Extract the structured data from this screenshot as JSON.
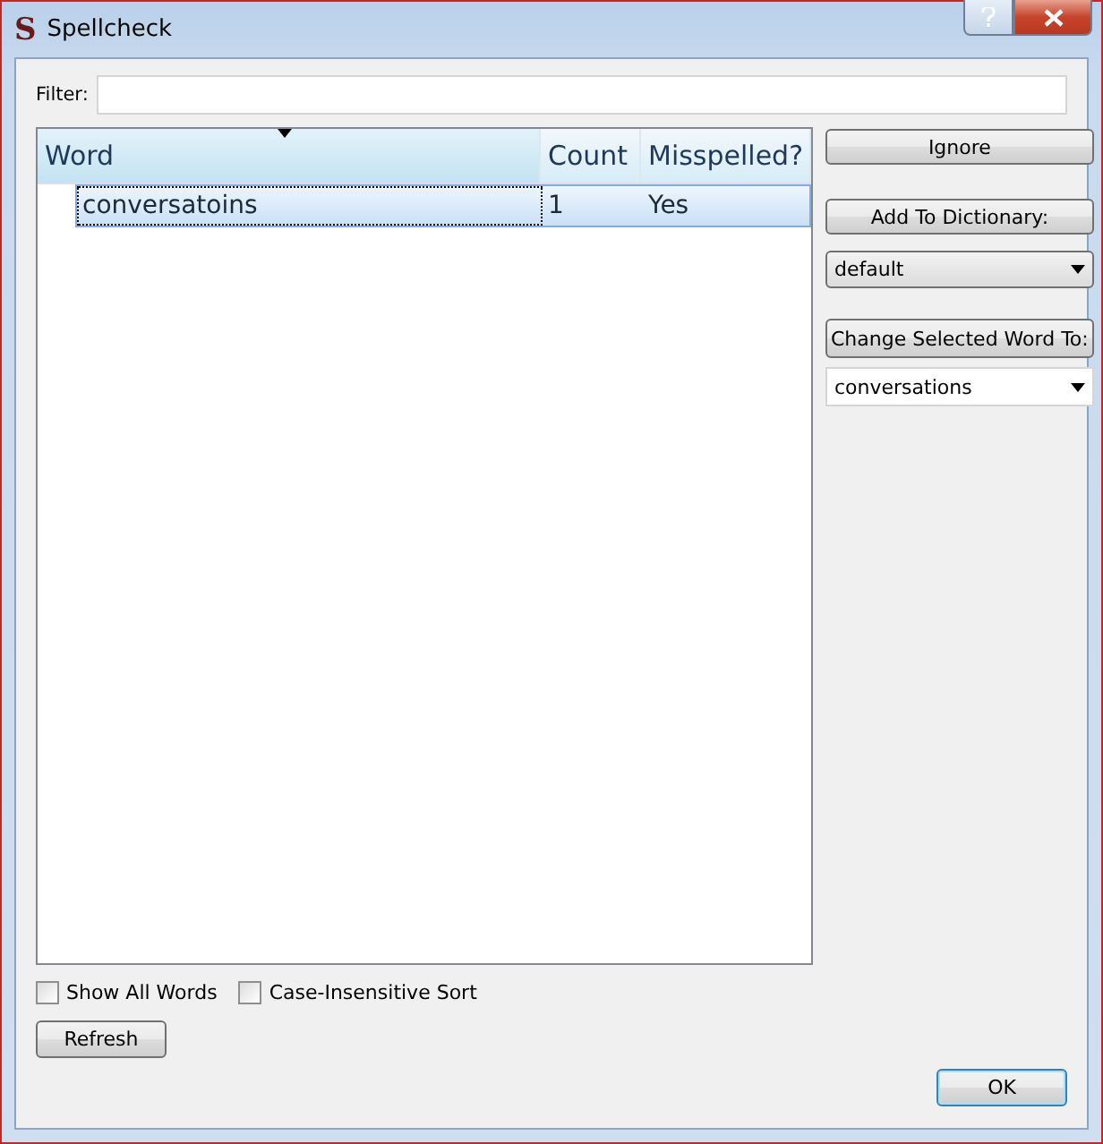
{
  "window": {
    "logo": "S",
    "title": "Spellcheck"
  },
  "filter": {
    "label": "Filter:"
  },
  "table": {
    "columns": [
      {
        "label": "Word",
        "sorted": true
      },
      {
        "label": "Count",
        "sorted": false
      },
      {
        "label": "Misspelled?",
        "sorted": false
      }
    ],
    "rows": [
      {
        "word": "conversatoins",
        "count": "1",
        "misspelled": "Yes",
        "selected": true
      }
    ]
  },
  "ignore_button": "Ignore",
  "add_button": "Add To Dictionary:",
  "dictionary": {
    "value": "default"
  },
  "change_button": "Change Selected Word To:",
  "replacement": {
    "value": "conversations"
  },
  "options": [
    {
      "label": "Show All Words",
      "checked": false
    },
    {
      "label": "Case-Insensitive Sort",
      "checked": false
    }
  ],
  "refresh_button": "Refresh",
  "ok_button": "OK"
}
